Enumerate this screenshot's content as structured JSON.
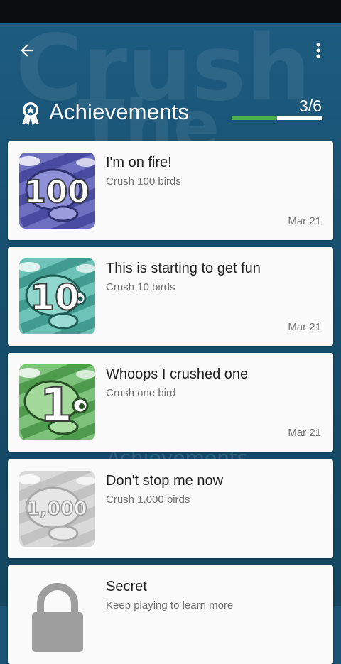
{
  "header": {
    "title": "Achievements",
    "progress_text": "3/6",
    "progress_fraction": 0.5,
    "back_icon": "arrow-back-icon",
    "menu_icon": "more-vert-icon",
    "award_icon": "award-icon"
  },
  "background": {
    "watermark_line1": "Crush",
    "watermark_line2": "The",
    "watermark_line3": "Achievements"
  },
  "colors": {
    "app_background": "#1b5475",
    "progress_fill": "#4caf50",
    "card_background": "#fafafa"
  },
  "achievements": [
    {
      "title": "I'm on fire!",
      "description": "Crush 100 birds",
      "date": "Mar 21",
      "badge": "100",
      "unlocked": true,
      "theme": "purple"
    },
    {
      "title": "This is starting to get fun",
      "description": "Crush 10 birds",
      "date": "Mar 21",
      "badge": "10",
      "unlocked": true,
      "theme": "teal"
    },
    {
      "title": "Whoops I crushed one",
      "description": "Crush one bird",
      "date": "Mar 21",
      "badge": "1",
      "unlocked": true,
      "theme": "green"
    },
    {
      "title": "Don't stop me now",
      "description": "Crush 1,000 birds",
      "date": "",
      "badge": "1,000",
      "unlocked": false,
      "theme": "grey"
    },
    {
      "title": "Secret",
      "description": "Keep playing to learn more",
      "date": "",
      "badge": "",
      "unlocked": false,
      "theme": "lock"
    }
  ]
}
